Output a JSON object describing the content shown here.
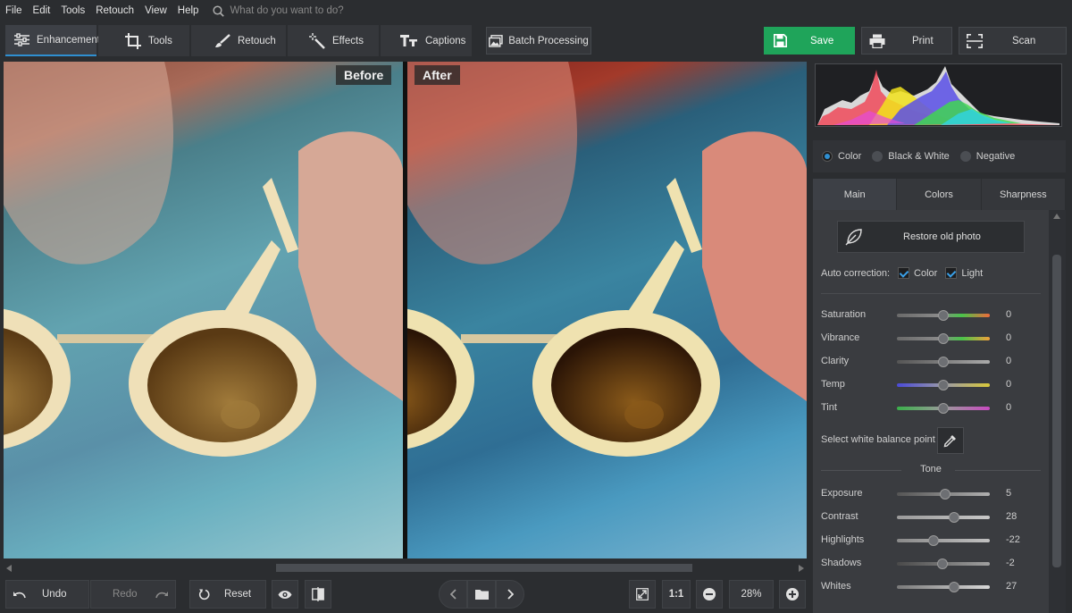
{
  "menu": [
    "File",
    "Edit",
    "Tools",
    "Retouch",
    "View",
    "Help"
  ],
  "search": {
    "placeholder": "What do you want to do?",
    "icon": "search-icon"
  },
  "tabs": [
    {
      "label": "Enhancement",
      "icon": "sliders-icon",
      "active": true
    },
    {
      "label": "Tools",
      "icon": "crop-icon"
    },
    {
      "label": "Retouch",
      "icon": "brush-icon"
    },
    {
      "label": "Effects",
      "icon": "magic-wand-icon"
    },
    {
      "label": "Captions",
      "icon": "text-icon"
    }
  ],
  "batch_label": "Batch Processing",
  "save_label": "Save",
  "print_label": "Print",
  "scan_label": "Scan",
  "preview": {
    "before_label": "Before",
    "after_label": "After"
  },
  "bottom": {
    "undo_label": "Undo",
    "redo_label": "Redo",
    "reset_label": "Reset",
    "ratio_label": "1:1",
    "zoom": "28%"
  },
  "mode": {
    "options": [
      "Color",
      "Black & White",
      "Negative"
    ],
    "selected": "Color"
  },
  "subtabs": [
    {
      "label": "Main",
      "active": true
    },
    {
      "label": "Colors"
    },
    {
      "label": "Sharpness"
    }
  ],
  "restore_label": "Restore old photo",
  "auto_correction": {
    "label": "Auto correction:",
    "color_label": "Color",
    "light_label": "Light",
    "color_checked": true,
    "light_checked": true
  },
  "colors_sliders": [
    {
      "name": "Saturation",
      "value": "0",
      "pos": 0.5
    },
    {
      "name": "Vibrance",
      "value": "0",
      "pos": 0.5
    },
    {
      "name": "Clarity",
      "value": "0",
      "pos": 0.5
    },
    {
      "name": "Temp",
      "value": "0",
      "pos": 0.5
    },
    {
      "name": "Tint",
      "value": "0",
      "pos": 0.5
    }
  ],
  "white_balance_label": "Select white balance point",
  "tone_label": "Tone",
  "tone_sliders": [
    {
      "name": "Exposure",
      "value": "5",
      "pos": 0.52
    },
    {
      "name": "Contrast",
      "value": "28",
      "pos": 0.62
    },
    {
      "name": "Highlights",
      "value": "-22",
      "pos": 0.39
    },
    {
      "name": "Shadows",
      "value": "-2",
      "pos": 0.49
    },
    {
      "name": "Whites",
      "value": "27",
      "pos": 0.62
    }
  ],
  "colors": {
    "accent": "#2f8fd1",
    "save_green": "#1fa45a"
  }
}
